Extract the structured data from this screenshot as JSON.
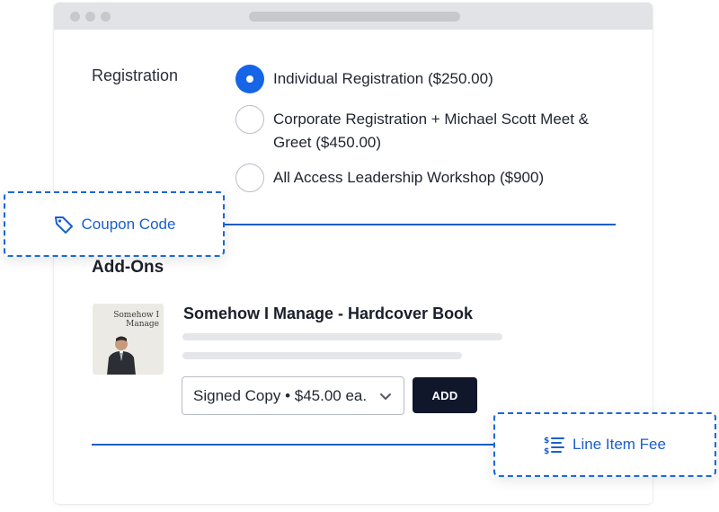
{
  "registration": {
    "label": "Registration",
    "options": [
      {
        "label": "Individual Registration  ($250.00)",
        "checked": true
      },
      {
        "label": "Corporate Registration + Michael Scott Meet & Greet  ($450.00)",
        "checked": false
      },
      {
        "label": "All Access Leadership Workshop ($900)",
        "checked": false
      }
    ]
  },
  "badges": {
    "coupon": {
      "label": "Coupon Code",
      "icon": "tag-icon"
    },
    "line_item_fee": {
      "label": "Line Item Fee",
      "icon": "dollar-list-icon"
    }
  },
  "addons": {
    "title": "Add-Ons",
    "product": {
      "title": "Somehow I Manage - Hardcover Book",
      "cover_text": "Somehow I Manage",
      "variant_selected": "Signed Copy • $45.00 ea.",
      "add_label": "ADD"
    }
  },
  "colors": {
    "accent": "#1565e6",
    "dark_button": "#10172b"
  }
}
